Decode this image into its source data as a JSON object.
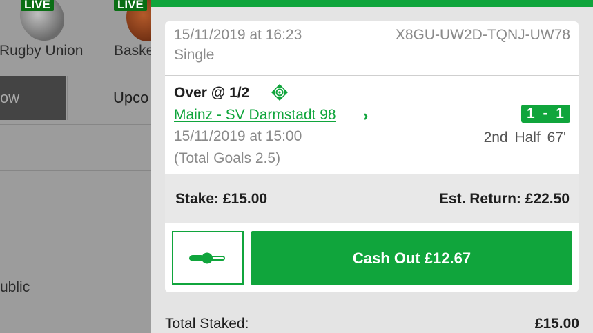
{
  "background": {
    "sports": [
      {
        "badge": "LIVE",
        "label": "Rugby Union",
        "icon": "rugby-ball-icon"
      },
      {
        "badge": "LIVE",
        "label": "Baske",
        "icon": "basketball-icon"
      }
    ],
    "tabs": [
      {
        "label": "ow"
      },
      {
        "label": "Upco"
      }
    ],
    "bottom_text": "ublic"
  },
  "bet": {
    "placed_date": "15/11/2019 at 16:23",
    "reference": "X8GU-UW2D-TQNJ-UW78",
    "bet_type": "Single",
    "selection": "Over @ 1/2",
    "cash_out_icon": "cash-out-icon",
    "match": "Mainz - SV Darmstadt 98",
    "score": "1 - 1",
    "match_date": "15/11/2019 at 15:00",
    "period": "2nd Half 67'",
    "market": "(Total Goals 2.5)",
    "stake": "Stake: £15.00",
    "est_return": "Est. Return: £22.50",
    "toggle_icon": "slider-toggle-icon",
    "cash_out_label": "Cash Out £12.67"
  },
  "totals": {
    "label": "Total Staked:",
    "value": "£15.00"
  },
  "colors": {
    "accent": "#10a53c",
    "live_badge": "#0a6e14"
  }
}
